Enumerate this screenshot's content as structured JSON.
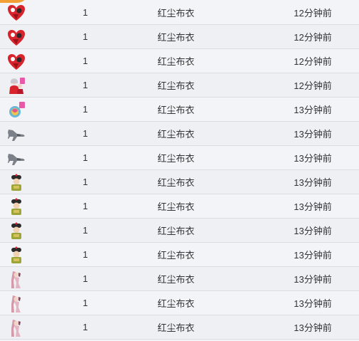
{
  "rows": [
    {
      "icon": "heart-roses-icon",
      "count": "1",
      "sender": "红尘布衣",
      "time": "12分钟前"
    },
    {
      "icon": "heart-roses-icon",
      "count": "1",
      "sender": "红尘布衣",
      "time": "12分钟前"
    },
    {
      "icon": "heart-roses-icon",
      "count": "1",
      "sender": "红尘布衣",
      "time": "12分钟前"
    },
    {
      "icon": "couple-gift-icon",
      "count": "1",
      "sender": "红尘布衣",
      "time": "12分钟前"
    },
    {
      "icon": "gift-charm-icon",
      "count": "1",
      "sender": "红尘布衣",
      "time": "13分钟前"
    },
    {
      "icon": "fighter-jet-icon",
      "count": "1",
      "sender": "红尘布衣",
      "time": "13分钟前"
    },
    {
      "icon": "fighter-jet-icon",
      "count": "1",
      "sender": "红尘布衣",
      "time": "13分钟前"
    },
    {
      "icon": "qing-official-icon",
      "count": "1",
      "sender": "红尘布衣",
      "time": "13分钟前"
    },
    {
      "icon": "qing-official-icon",
      "count": "1",
      "sender": "红尘布衣",
      "time": "13分钟前"
    },
    {
      "icon": "qing-official-icon",
      "count": "1",
      "sender": "红尘布衣",
      "time": "13分钟前"
    },
    {
      "icon": "qing-official-icon",
      "count": "1",
      "sender": "红尘布衣",
      "time": "13分钟前"
    },
    {
      "icon": "dancer-icon",
      "count": "1",
      "sender": "红尘布衣",
      "time": "13分钟前"
    },
    {
      "icon": "dancer-icon",
      "count": "1",
      "sender": "红尘布衣",
      "time": "13分钟前"
    },
    {
      "icon": "dancer-icon",
      "count": "1",
      "sender": "红尘布衣",
      "time": "13分钟前"
    }
  ]
}
